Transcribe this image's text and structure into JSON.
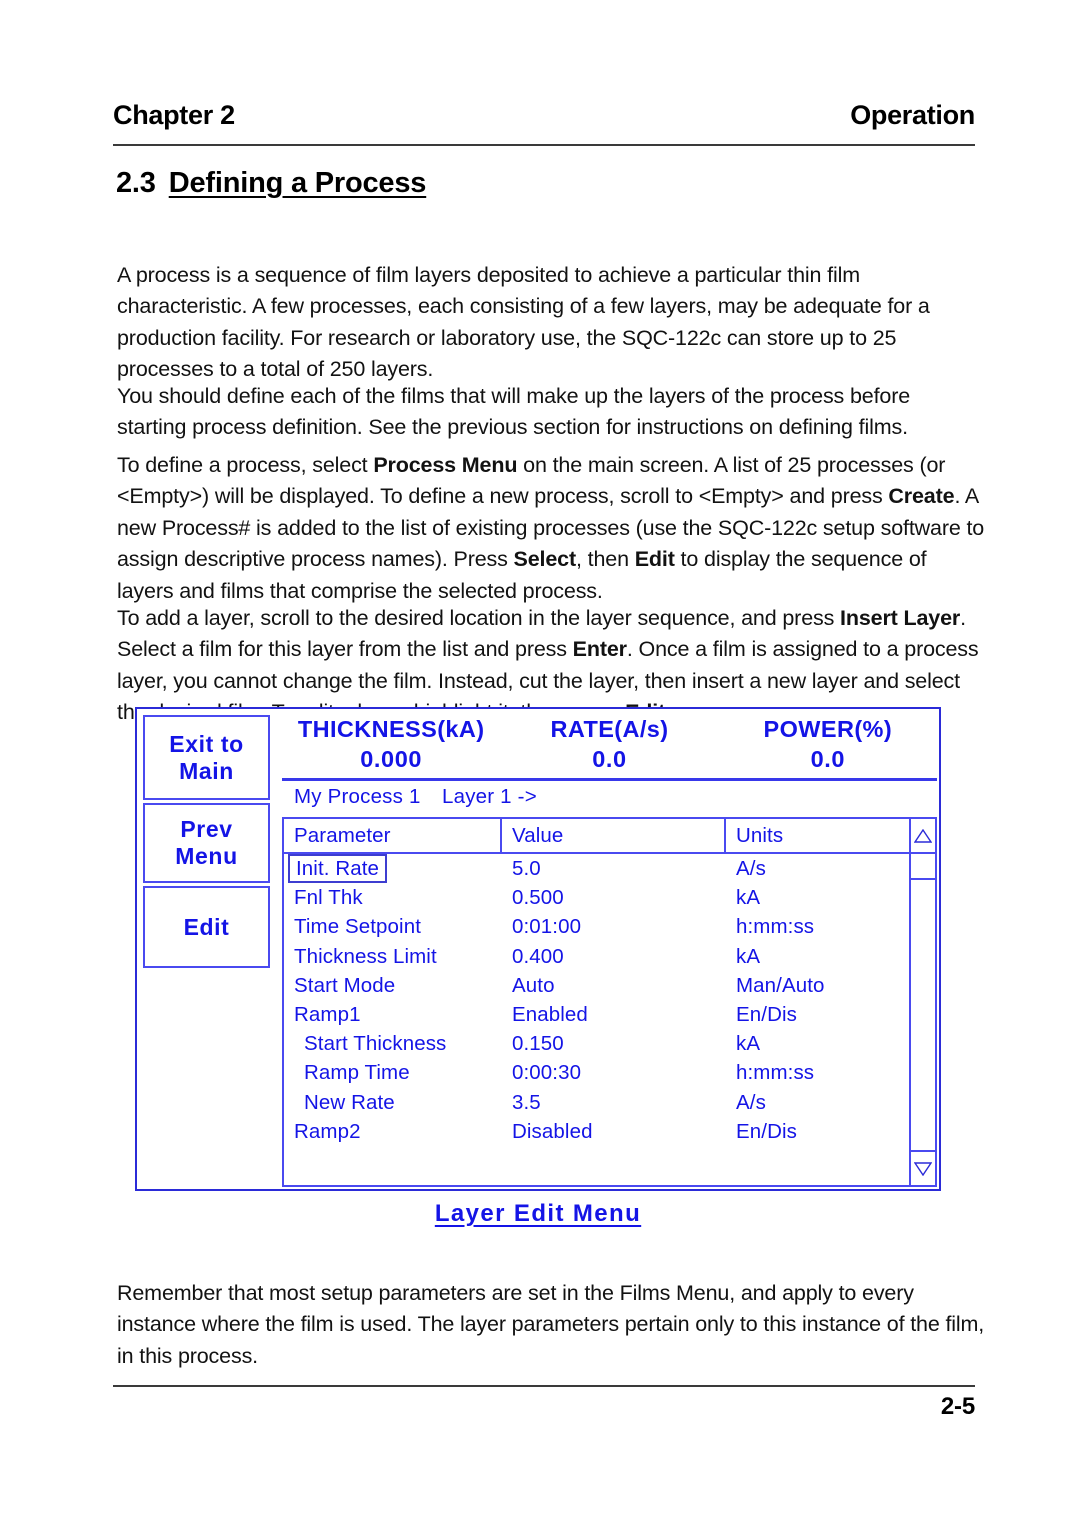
{
  "running_head": {
    "left": "Chapter 2",
    "right": "Operation"
  },
  "section": {
    "number": "2.3",
    "title": "Defining a Process"
  },
  "paragraphs": {
    "p1_a": "A process is a sequence of film layers deposited to achieve a particular thin film characteristic.  A few processes, each consisting of a few layers, may be adequate for a production facility.  For research or laboratory use, the SQC-122c can store up to 25 processes to a total of 250 layers.",
    "p2_a": "You should define each of the films that will make up the layers of the process before starting process definition.  See the previous section for instructions on defining films.",
    "p3_a": "To define a process, select ",
    "p3_b1": "Process Menu",
    "p3_c": " on the main screen.  A list of 25 processes (or <Empty>) will be displayed.  To define a new process, scroll to <Empty> and press ",
    "p3_b2": "Create",
    "p3_d": ".  A new Process# is added to the list of existing processes (use the SQC-122c setup software to assign descriptive process names).  Press ",
    "p3_b3": "Select",
    "p3_e": ", then ",
    "p3_b4": "Edit",
    "p3_f": " to display the sequence of layers and films that comprise the selected process.",
    "p4_a": "To add a layer, scroll to the desired location in the layer sequence, and press ",
    "p4_b1": "Insert Layer",
    "p4_c": ".  Select a film for this layer from the list and press ",
    "p4_b2": "Enter",
    "p4_d": ".  Once a film is assigned to a process layer, you cannot change the film.  Instead, cut the layer, then insert a new layer and select the desired film. To edit a layer, highlight it, then press ",
    "p4_b3": "Edit.",
    "p5_a": "Remember that most setup parameters are set in the Films Menu, and apply to every instance where the film is used.  The layer parameters pertain only to this instance of the film, in this process."
  },
  "figure": {
    "caption": "Layer Edit Menu",
    "accent_color": "#1414e6",
    "softkeys": [
      {
        "line1": "Exit to",
        "line2": "Main"
      },
      {
        "line1": "Prev",
        "line2": "Menu"
      },
      {
        "line1": "Edit",
        "line2": ""
      }
    ],
    "readouts": [
      {
        "label": "THICKNESS(kA)",
        "value": "0.000"
      },
      {
        "label": "RATE(A/s)",
        "value": "0.0"
      },
      {
        "label": "POWER(%)",
        "value": "0.0"
      }
    ],
    "breadcrumb": {
      "process": "My Process 1",
      "layer": "Layer 1 ->"
    },
    "table": {
      "headers": [
        "Parameter",
        "Value",
        "Units"
      ],
      "rows": [
        {
          "parameter": "Init. Rate",
          "value": "5.0",
          "units": "A/s",
          "indent": false,
          "selected": true
        },
        {
          "parameter": "Fnl Thk",
          "value": "0.500",
          "units": "kA",
          "indent": false,
          "selected": false
        },
        {
          "parameter": "Time Setpoint",
          "value": "0:01:00",
          "units": "h:mm:ss",
          "indent": false,
          "selected": false
        },
        {
          "parameter": "Thickness Limit",
          "value": "0.400",
          "units": "kA",
          "indent": false,
          "selected": false
        },
        {
          "parameter": "Start Mode",
          "value": "Auto",
          "units": "Man/Auto",
          "indent": false,
          "selected": false
        },
        {
          "parameter": "Ramp1",
          "value": "Enabled",
          "units": "En/Dis",
          "indent": false,
          "selected": false
        },
        {
          "parameter": "Start Thickness",
          "value": "0.150",
          "units": "kA",
          "indent": true,
          "selected": false
        },
        {
          "parameter": "Ramp Time",
          "value": "0:00:30",
          "units": "h:mm:ss",
          "indent": true,
          "selected": false
        },
        {
          "parameter": "New Rate",
          "value": "3.5",
          "units": "A/s",
          "indent": true,
          "selected": false
        },
        {
          "parameter": "Ramp2",
          "value": "Disabled",
          "units": "En/Dis",
          "indent": false,
          "selected": false
        }
      ]
    },
    "scrollbar": {
      "up_icon": "triangle-up-icon",
      "down_icon": "triangle-down-icon"
    }
  },
  "footer": {
    "page_number": "2-5"
  }
}
